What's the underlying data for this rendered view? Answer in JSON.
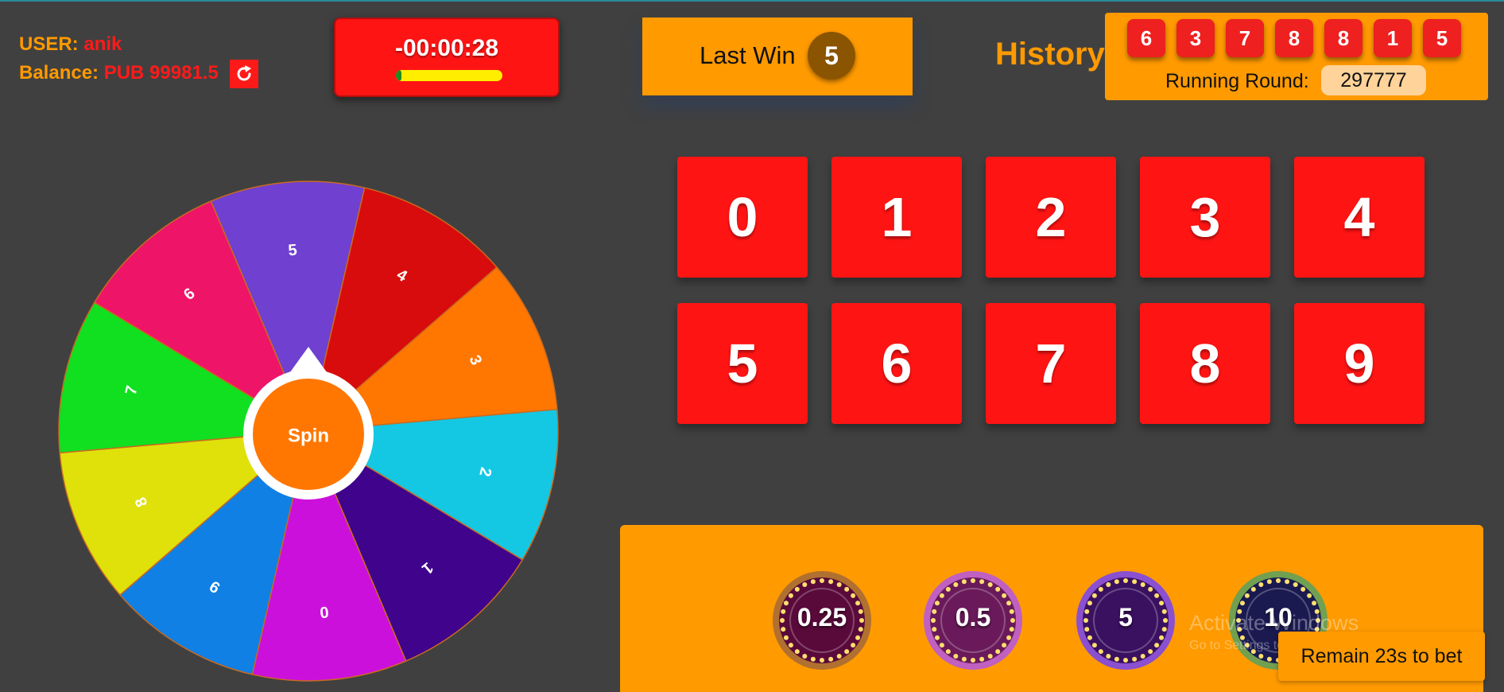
{
  "user": {
    "user_label": "USER:",
    "username": "anik",
    "balance_label": "Balance:",
    "balance_value": "PUB 99981.5"
  },
  "timer": {
    "time": "-00:00:28",
    "progress": 0.05,
    "bar_color": "#ffee00",
    "fill_color": "#1f8a1f"
  },
  "last_win": {
    "label": "Last Win",
    "value": "5"
  },
  "history": {
    "label": "History:",
    "balls": [
      "6",
      "3",
      "7",
      "8",
      "8",
      "1",
      "5"
    ],
    "running_round_label": "Running Round:",
    "running_round_value": "297777"
  },
  "wheel": {
    "spin_label": "Spin",
    "segments": [
      {
        "label": "5",
        "color": "#7040d0"
      },
      {
        "label": "4",
        "color": "#d80c0c"
      },
      {
        "label": "3",
        "color": "#ff7700"
      },
      {
        "label": "2",
        "color": "#14c8e4"
      },
      {
        "label": "1",
        "color": "#3f038c"
      },
      {
        "label": "0",
        "color": "#cc10dc"
      },
      {
        "label": "9",
        "color": "#1080e4"
      },
      {
        "label": "8",
        "color": "#e0e00a"
      },
      {
        "label": "7",
        "color": "#10e020"
      },
      {
        "label": "6",
        "color": "#ee1468"
      }
    ],
    "hub_color": "#ff7700"
  },
  "numbers": [
    "0",
    "1",
    "2",
    "3",
    "4",
    "5",
    "6",
    "7",
    "8",
    "9"
  ],
  "chips": [
    {
      "value": "0.25",
      "color": "#5a0a3a",
      "ring": "#b07030"
    },
    {
      "value": "0.5",
      "color": "#6a1a5a",
      "ring": "#c060c0"
    },
    {
      "value": "5",
      "color": "#3a1060",
      "ring": "#8a50d0"
    },
    {
      "value": "10",
      "color": "#1a1a50",
      "ring": "#70a050"
    }
  ],
  "watermark": {
    "line1": "Activate Windows",
    "line2": "Go to Settings to activate Windows."
  },
  "remain_text": "Remain 23s to bet",
  "colors": {
    "background": "#404040",
    "accent_orange": "#ff9a00",
    "accent_red": "#ff1414"
  }
}
